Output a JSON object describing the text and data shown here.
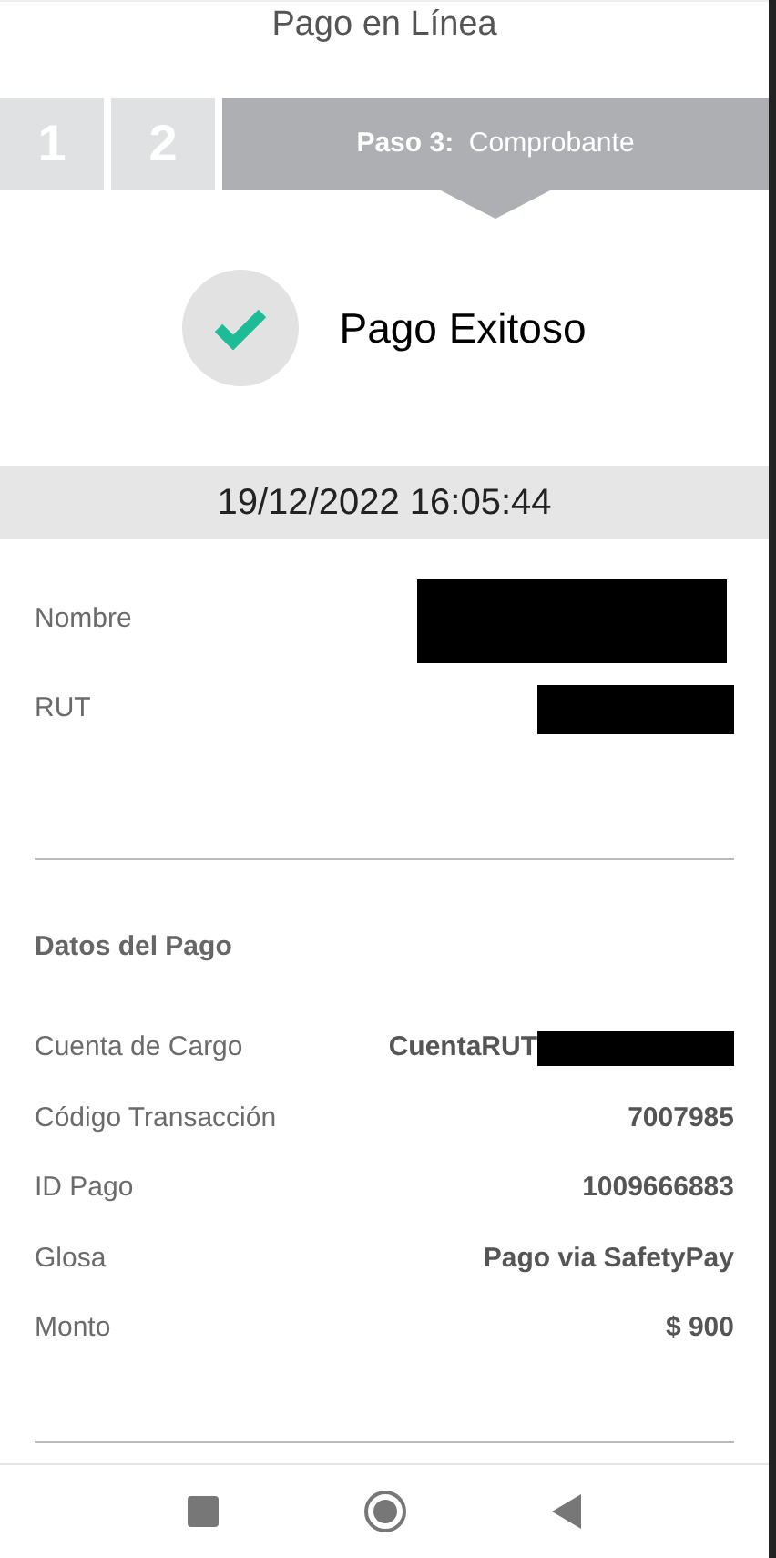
{
  "title": "Pago en Línea",
  "steps": [
    {
      "label": "1",
      "selected": false
    },
    {
      "label": "2",
      "selected": false
    },
    {
      "label": "**Paso 3:**  Comprobante",
      "selected": true
    }
  ],
  "status": {
    "text": "Pago Exitoso",
    "success": true
  },
  "datetime": "19/12/2022 16:05:44",
  "client_rows": [
    {
      "label": "Nombre",
      "redacted": true
    },
    {
      "label": "RUT",
      "redacted": true
    }
  ],
  "payment_section": {
    "heading": "Datos del Pago",
    "rows": [
      {
        "label": "Cuenta de Cargo",
        "value": "CuentaRUT",
        "redacted": true
      },
      {
        "label": "Código Transacción",
        "value": "7007985",
        "redacted": false
      },
      {
        "label": "ID Pago",
        "value": "1009666883",
        "redacted": false
      },
      {
        "label": "Glosa",
        "value": "Pago via SafetyPay",
        "redacted": false
      },
      {
        "label": "Monto",
        "value": "$ 900",
        "redacted": false
      }
    ]
  }
}
